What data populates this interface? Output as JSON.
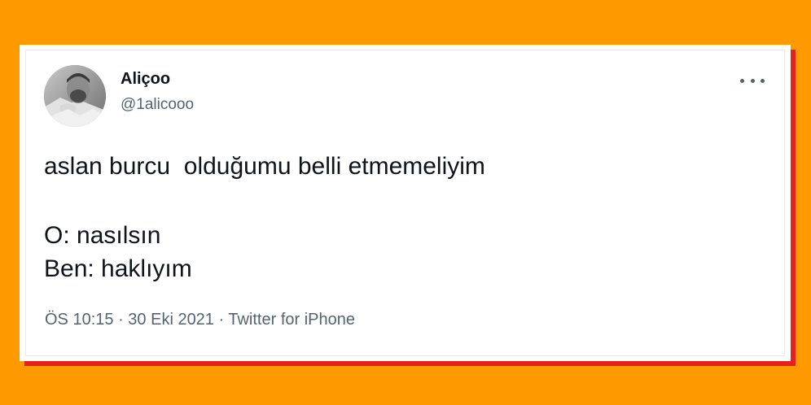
{
  "tweet": {
    "author": {
      "display_name": "Aliçoo",
      "handle": "@1alicooo",
      "avatar_icon": "user-avatar-photo"
    },
    "more_icon": "more-options-icon",
    "text_lines": [
      "aslan burcu  olduğumu belli etmemeliyim",
      "",
      "O: nasılsın",
      "Ben: haklıyım"
    ],
    "meta": {
      "time": "ÖS 10:15",
      "separator": " · ",
      "date": "30 Eki 2021",
      "source": "Twitter for iPhone"
    }
  },
  "colors": {
    "background": "#ff9900",
    "card_shadow": "#e6201c",
    "card": "#ffffff",
    "text_primary": "#0f1419",
    "text_secondary": "#536471"
  }
}
